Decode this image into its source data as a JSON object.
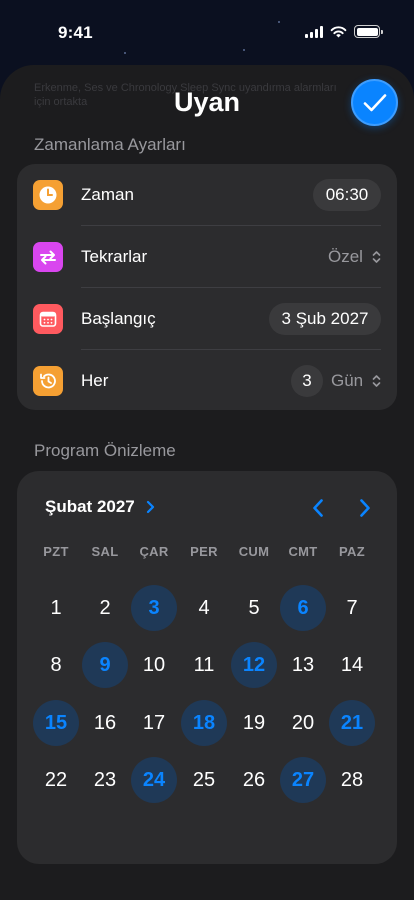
{
  "status_bar": {
    "time": "9:41"
  },
  "sheet": {
    "background_text": "Erkenme, Ses ve Chronology Sleep Sync uyandırma alarmları için ortakta",
    "title": "Uyan",
    "confirm_icon": "checkmark-icon",
    "accent_color": "#0a84ff"
  },
  "schedule_settings": {
    "section_title": "Zamanlama Ayarları",
    "rows": [
      {
        "label": "Zaman",
        "value": "06:30",
        "icon": "clock-icon",
        "icon_color": "#f5a033"
      },
      {
        "label": "Tekrarlar",
        "value": "Özel",
        "icon": "repeat-icon",
        "icon_color": "#d946ef"
      },
      {
        "label": "Başlangıç",
        "value": "3 Şub 2027",
        "icon": "calendar-icon",
        "icon_color": "#ff5a5f"
      },
      {
        "label": "Her",
        "count": "3",
        "unit": "Gün",
        "icon": "history-icon",
        "icon_color": "#f5a033"
      }
    ]
  },
  "preview": {
    "section_title": "Program Önizleme",
    "month_label": "Şubat 2027",
    "weekdays": [
      "PZT",
      "SAL",
      "ÇAR",
      "PER",
      "CUM",
      "CMT",
      "PAZ"
    ],
    "days": [
      {
        "n": "1",
        "hl": false
      },
      {
        "n": "2",
        "hl": false
      },
      {
        "n": "3",
        "hl": true
      },
      {
        "n": "4",
        "hl": false
      },
      {
        "n": "5",
        "hl": false
      },
      {
        "n": "6",
        "hl": true
      },
      {
        "n": "7",
        "hl": false
      },
      {
        "n": "8",
        "hl": false
      },
      {
        "n": "9",
        "hl": true
      },
      {
        "n": "10",
        "hl": false
      },
      {
        "n": "11",
        "hl": false
      },
      {
        "n": "12",
        "hl": true
      },
      {
        "n": "13",
        "hl": false
      },
      {
        "n": "14",
        "hl": false
      },
      {
        "n": "15",
        "hl": true
      },
      {
        "n": "16",
        "hl": false
      },
      {
        "n": "17",
        "hl": false
      },
      {
        "n": "18",
        "hl": true
      },
      {
        "n": "19",
        "hl": false
      },
      {
        "n": "20",
        "hl": false
      },
      {
        "n": "21",
        "hl": true
      },
      {
        "n": "22",
        "hl": false
      },
      {
        "n": "23",
        "hl": false
      },
      {
        "n": "24",
        "hl": true
      },
      {
        "n": "25",
        "hl": false
      },
      {
        "n": "26",
        "hl": false
      },
      {
        "n": "27",
        "hl": true
      },
      {
        "n": "28",
        "hl": false
      }
    ]
  }
}
